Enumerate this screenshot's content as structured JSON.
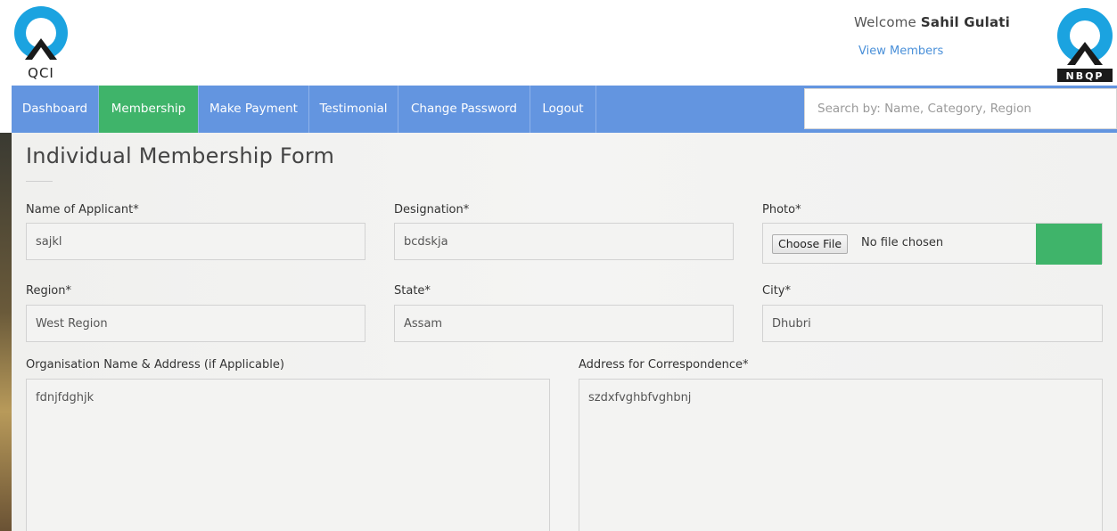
{
  "header": {
    "logo_left_text": "QCI",
    "logo_right_text": "NBQP",
    "welcome_prefix": "Welcome",
    "user_name": "Sahil Gulati",
    "view_members": "View Members"
  },
  "nav": {
    "items": [
      {
        "label": "Dashboard",
        "active": false
      },
      {
        "label": "Membership",
        "active": true
      },
      {
        "label": "Make Payment",
        "active": false
      },
      {
        "label": "Testimonial",
        "active": false
      },
      {
        "label": "Change Password",
        "active": false
      },
      {
        "label": "Logout",
        "active": false
      }
    ],
    "search_placeholder": "Search by: Name, Category, Region"
  },
  "form": {
    "title": "Individual Membership Form",
    "name": {
      "label": "Name of Applicant*",
      "value": "sajkl"
    },
    "designation": {
      "label": "Designation*",
      "value": "bcdskja"
    },
    "photo": {
      "label": "Photo*",
      "button": "Choose File",
      "status": "No file chosen"
    },
    "region": {
      "label": "Region*",
      "value": "West Region"
    },
    "state": {
      "label": "State*",
      "value": "Assam"
    },
    "city": {
      "label": "City*",
      "value": "Dhubri"
    },
    "organisation": {
      "label": "Organisation Name & Address (if Applicable)",
      "value": "fdnjfdghjk"
    },
    "correspondence": {
      "label": "Address for Correspondence*",
      "value": "szdxfvghbfvghbnj"
    }
  },
  "colors": {
    "nav_bg": "#6395e0",
    "nav_active": "#3fb46a",
    "link": "#4a90d9"
  }
}
